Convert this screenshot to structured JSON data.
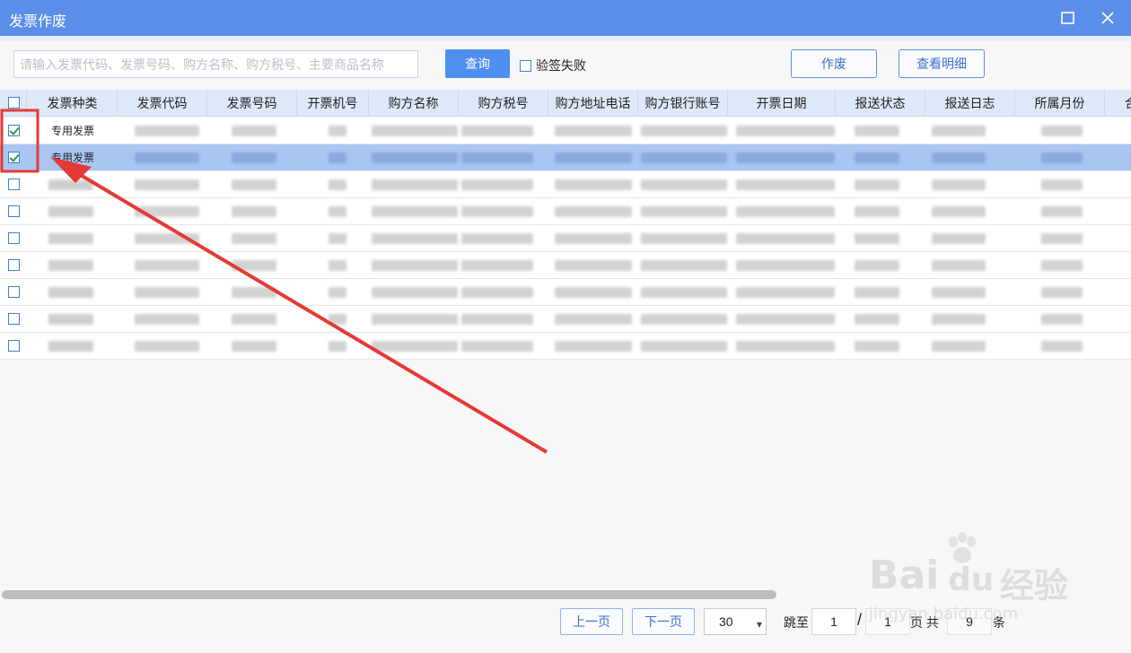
{
  "window": {
    "title": "发票作废"
  },
  "toolbar": {
    "search_placeholder": "请输入发票代码、发票号码、购方名称、购方税号、主要商品名称",
    "query_label": "查询",
    "verify_fail_label": "验签失败",
    "void_label": "作废",
    "detail_label": "查看明细"
  },
  "table": {
    "columns": [
      "发票种类",
      "发票代码",
      "发票号码",
      "开票机号",
      "购方名称",
      "购方税号",
      "购方地址电话",
      "购方银行账号",
      "开票日期",
      "报送状态",
      "报送日志",
      "所属月份",
      "合"
    ],
    "rows": [
      {
        "type": "专用发票",
        "checked": true
      },
      {
        "type": "专用发票",
        "checked": true,
        "selected": true
      },
      {
        "type": "",
        "checked": false
      },
      {
        "type": "",
        "checked": false
      },
      {
        "type": "",
        "checked": false
      },
      {
        "type": "",
        "checked": false
      },
      {
        "type": "",
        "checked": false
      },
      {
        "type": "",
        "checked": false
      },
      {
        "type": "",
        "checked": false
      }
    ]
  },
  "pager": {
    "prev_label": "上一页",
    "next_label": "下一页",
    "page_size": "30",
    "jump_label": "跳至",
    "current_page": "1",
    "slash": "/",
    "total_pages": "1",
    "page_total_label": "页 共",
    "total_count": "9",
    "count_unit": "条"
  },
  "watermark": {
    "brand": "Bai",
    "brand2": "du",
    "brand_cn": "经验",
    "url": "jingyan.baidu.com"
  },
  "colors": {
    "titlebar": "#5b8ee8",
    "accent": "#4f8ff2",
    "selected_row": "#a9c6f3",
    "annotation": "#e53935"
  }
}
